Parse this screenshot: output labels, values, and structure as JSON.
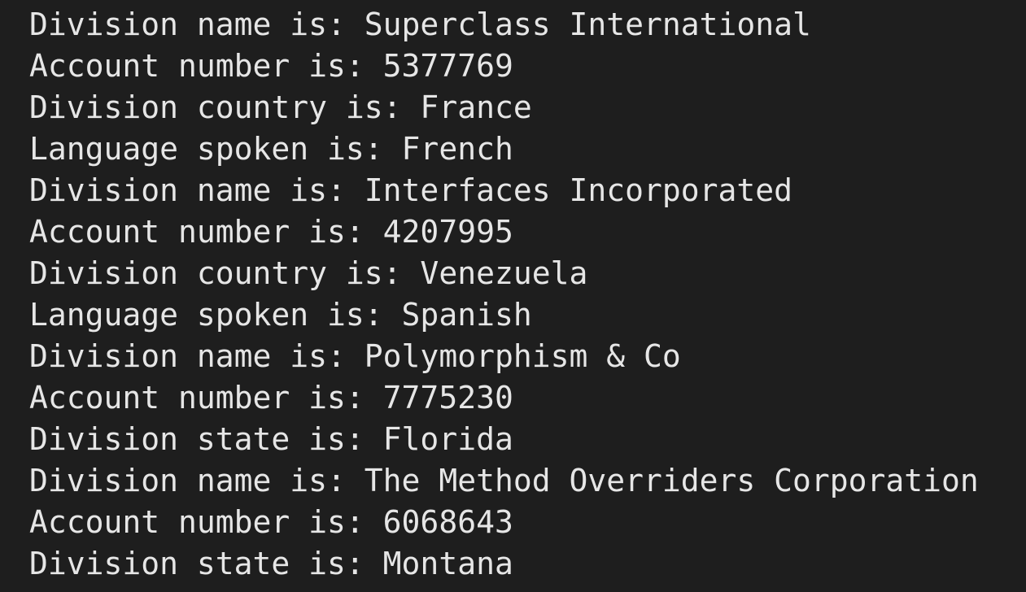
{
  "terminal": {
    "background": "#1e1e1e",
    "foreground": "#e6e6e6",
    "lines": [
      "Division name is: Superclass International",
      "Account number is: 5377769",
      "Division country is: France",
      "Language spoken is: French",
      "Division name is: Interfaces Incorporated",
      "Account number is: 4207995",
      "Division country is: Venezuela",
      "Language spoken is: Spanish",
      "Division name is: Polymorphism & Co",
      "Account number is: 7775230",
      "Division state is: Florida",
      "Division name is: The Method Overriders Corporation",
      "Account number is: 6068643",
      "Division state is: Montana"
    ]
  }
}
